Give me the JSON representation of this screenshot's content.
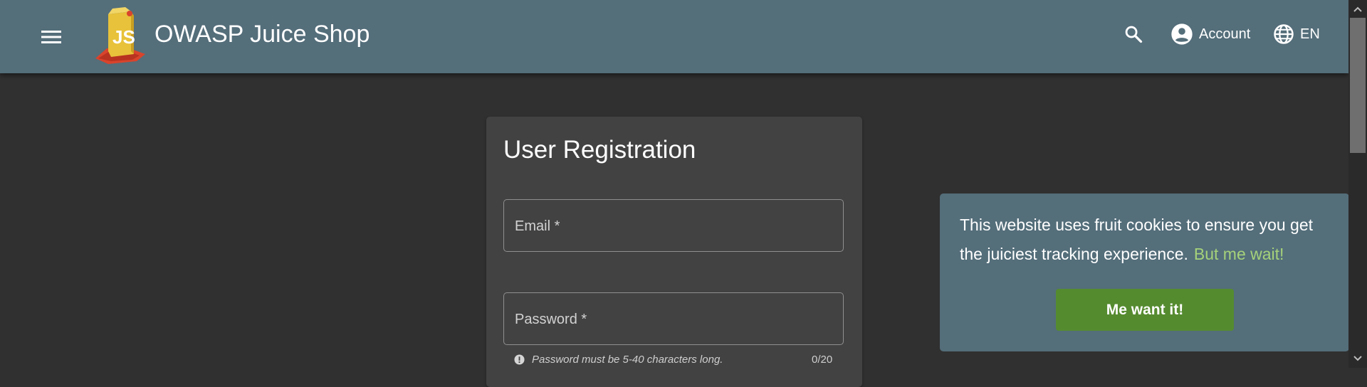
{
  "header": {
    "title": "OWASP Juice Shop",
    "menu_icon": "menu-icon",
    "search_icon": "search-icon",
    "account_label": "Account",
    "account_icon": "account-circle-icon",
    "language_label": "EN",
    "language_icon": "globe-icon",
    "bg_color": "#546e7a"
  },
  "registration": {
    "title": "User Registration",
    "email_label": "Email *",
    "password_label": "Password *",
    "password_hint": "Password must be 5-40 characters long.",
    "password_counter": "0/20",
    "hint_icon": "info-circle-icon"
  },
  "cookie_banner": {
    "message": "This website uses fruit cookies to ensure you get the juiciest tracking experience.",
    "link_text": "But me wait!",
    "button_label": "Me want it!",
    "button_color": "#558b2f",
    "link_color": "#a5d27a"
  },
  "colors": {
    "page_bg": "#303030",
    "card_bg": "#424242"
  }
}
